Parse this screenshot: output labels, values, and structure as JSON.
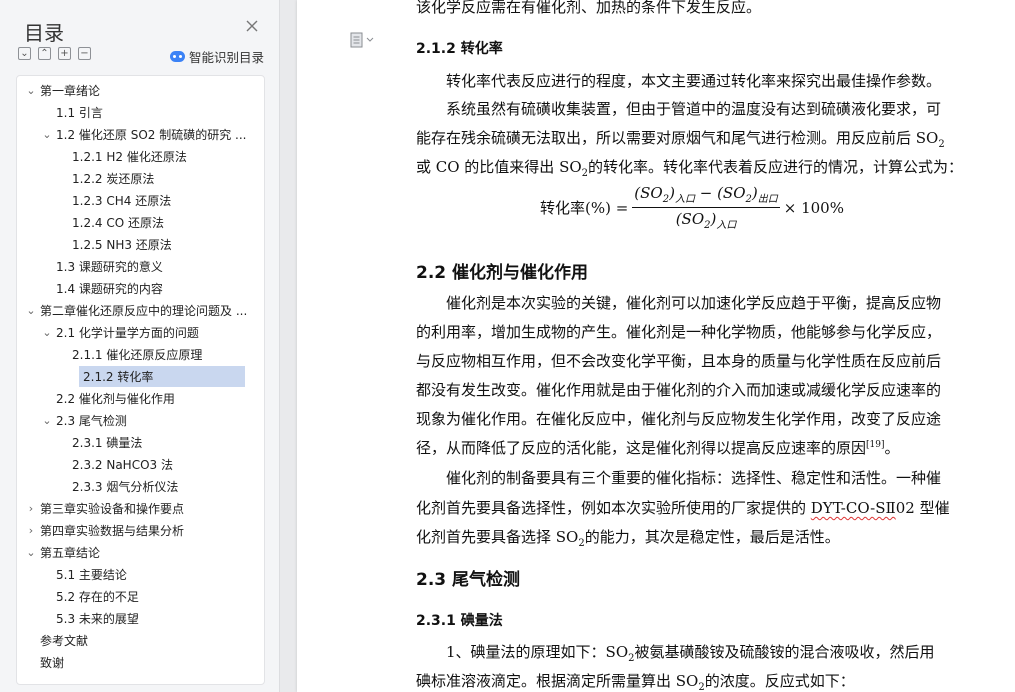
{
  "sidebar": {
    "title": "目录",
    "smart_toc_label": "智能识别目录",
    "items": [
      {
        "label": "第一章绪论",
        "level": 0,
        "chevron": "⌄"
      },
      {
        "label": "1.1 引言",
        "level": 1,
        "chevron": ""
      },
      {
        "label": "1.2 催化还原 SO2 制硫磺的研究 ...",
        "level": 1,
        "chevron": "⌄"
      },
      {
        "label": "1.2.1 H2 催化还原法",
        "level": 2,
        "chevron": ""
      },
      {
        "label": "1.2.2 炭还原法",
        "level": 2,
        "chevron": ""
      },
      {
        "label": "1.2.3 CH4 还原法",
        "level": 2,
        "chevron": ""
      },
      {
        "label": "1.2.4 CO 还原法",
        "level": 2,
        "chevron": ""
      },
      {
        "label": "1.2.5 NH3 还原法",
        "level": 2,
        "chevron": ""
      },
      {
        "label": "1.3 课题研究的意义",
        "level": 1,
        "chevron": ""
      },
      {
        "label": "1.4 课题研究的内容",
        "level": 1,
        "chevron": ""
      },
      {
        "label": "第二章催化还原反应中的理论问题及 ...",
        "level": 0,
        "chevron": "⌄"
      },
      {
        "label": "2.1 化学计量学方面的问题",
        "level": 1,
        "chevron": "⌄"
      },
      {
        "label": "2.1.1 催化还原反应原理",
        "level": 2,
        "chevron": ""
      },
      {
        "label": "2.1.2 转化率",
        "level": 2,
        "chevron": "",
        "selected": true
      },
      {
        "label": "2.2 催化剂与催化作用",
        "level": 1,
        "chevron": ""
      },
      {
        "label": "2.3 尾气检测",
        "level": 1,
        "chevron": "⌄"
      },
      {
        "label": "2.3.1 碘量法",
        "level": 2,
        "chevron": ""
      },
      {
        "label": "2.3.2 NaHCO3 法",
        "level": 2,
        "chevron": ""
      },
      {
        "label": "2.3.3 烟气分析仪法",
        "level": 2,
        "chevron": ""
      },
      {
        "label": "第三章实验设备和操作要点",
        "level": 0,
        "chevron": "›"
      },
      {
        "label": "第四章实验数据与结果分析",
        "level": 0,
        "chevron": "›"
      },
      {
        "label": "第五章结论",
        "level": 0,
        "chevron": "⌄"
      },
      {
        "label": "5.1 主要结论",
        "level": 1,
        "chevron": ""
      },
      {
        "label": "5.2 存在的不足",
        "level": 1,
        "chevron": ""
      },
      {
        "label": "5.3 未来的展望",
        "level": 1,
        "chevron": ""
      },
      {
        "label": "参考文献",
        "level": 0,
        "chevron": ""
      },
      {
        "label": "致谢",
        "level": 0,
        "chevron": ""
      }
    ]
  },
  "document": {
    "top_line": "该化学反应需在有催化剂、加热的条件下发生反应。",
    "h_212": "2.1.2 转化率",
    "p1": "转化率代表反应进行的程度，本文主要通过转化率来探究出最佳操作参数。",
    "p2_l1": "系统虽然有硫磺收集装置，但由于管道中的温度没有达到硫磺液化要求，可",
    "p2_l2": "能存在残余硫磺无法取出，所以需要对原烟气和尾气进行检测。用反应前后 SO",
    "p2_l2_sub": "2",
    "p2_l3a": "或 CO 的比值来得出 SO",
    "p2_l3_sub": "2",
    "p2_l3b": "的转化率。转化率代表着反应进行的情况，计算公式为：",
    "formula": {
      "lhs": "转化率(%) =",
      "num_a": "(SO",
      "num_a_sub": "2",
      "num_a_close": ")",
      "num_a_sub2": "入口",
      "minus": " − ",
      "num_b": "(SO",
      "num_b_sub": "2",
      "num_b_close": ")",
      "num_b_sub2": "出口",
      "den": "(SO",
      "den_sub": "2",
      "den_close": ")",
      "den_sub2": "入口",
      "rhs": "× 100%"
    },
    "h_22": "2.2 催化剂与催化作用",
    "p3_l1": "催化剂是本次实验的关键，催化剂可以加速化学反应趋于平衡，提高反应物",
    "p3_l2": "的利用率，增加生成物的产生。催化剂是一种化学物质，他能够参与化学反应，",
    "p3_l3": "与反应物相互作用，但不会改变化学平衡，且本身的质量与化学性质在反应前后",
    "p3_l4": "都没有发生改变。催化作用就是由于催化剂的介入而加速或减缓化学反应速率的",
    "p3_l5": "现象为催化作用。在催化反应中，催化剂与反应物发生化学作用，改变了反应途",
    "p3_l6": "径，从而降低了反应的活化能，这是催化剂得以提高反应速率的原因",
    "p3_ref": "[19]",
    "p3_end": "。",
    "p4_l1": "催化剂的制备要具有三个重要的催化指标：选择性、稳定性和活性。一种催",
    "p4_l2a": "化剂首先要具备选择性，例如本次实验所使用的厂家提供的 ",
    "p4_l2b": "DYT-CO-SⅡ",
    "p4_l2c": "02 型催",
    "p4_l3a": "化剂首先要具备选择 SO",
    "p4_l3_sub": "2",
    "p4_l3b": "的能力，其次是稳定性，最后是活性。",
    "h_23": "2.3 尾气检测",
    "h_231": "2.3.1 碘量法",
    "p5_l1a": "1、碘量法的原理如下：SO",
    "p5_l1_sub": "2",
    "p5_l1b": "被氨基磺酸铵及硫酸铵的混合液吸收，然后用",
    "p5_l2a": "碘标准溶液滴定。根据滴定所需量算出 SO",
    "p5_l2_sub": "2",
    "p5_l2b": "的浓度。反应式如下："
  }
}
